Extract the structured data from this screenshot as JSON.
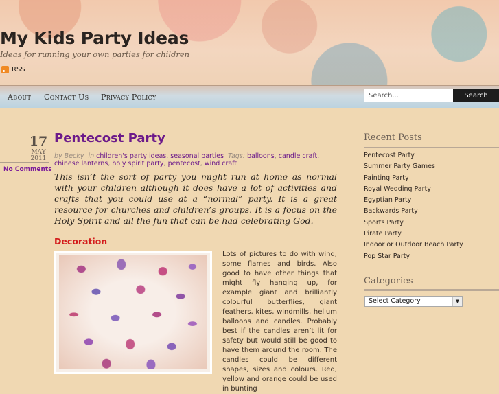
{
  "site": {
    "title": "My Kids Party Ideas",
    "tagline": "Ideas for running your own parties for children",
    "rss_label": "RSS"
  },
  "nav": {
    "items": [
      "About",
      "Contact Us",
      "Privacy Policy"
    ],
    "search_placeholder": "Search...",
    "search_button": "Search"
  },
  "post": {
    "date": {
      "day": "17",
      "month": "MAY",
      "year": "2011"
    },
    "comments": "No Comments",
    "title": "Pentecost Party",
    "meta": {
      "by": "by Becky",
      "in": "in",
      "categories": [
        "children's party ideas",
        "seasonal parties"
      ],
      "tags_label": "Tags:",
      "tags": [
        "balloons",
        "candle craft",
        "chinese lanterns",
        "holy spirit party",
        "pentecost",
        "wind craft"
      ]
    },
    "intro": "This isn’t the sort of party you might run at home as normal with your children although it does have a lot of activities and crafts that you could use at a “normal” party.  It is a great resource for churches and children’s groups.  It is a focus on the Holy Spirit and all the fun that can be had celebrating God.",
    "section_heading": "Decoration",
    "description": "Lots of pictures to do with wind, some flames and birds. Also good to have other things that might fly hanging up, for example giant and brilliantly colourful butterflies, giant feathers, kites, windmills, helium balloons and candles. Probably best if the candles aren’t lit for safety but would still be good to have them around the room.  The candles could be different shapes, sizes and colours. Red, yellow and orange could be used in bunting"
  },
  "sidebar": {
    "recent_heading": "Recent Posts",
    "recent_posts": [
      "Pentecost Party",
      "Summer Party Games",
      "Painting Party",
      "Royal Wedding Party",
      "Egyptian Party",
      "Backwards Party",
      "Sports Party",
      "Pirate Party",
      "Indoor or Outdoor Beach Party",
      "Pop Star Party"
    ],
    "categories_heading": "Categories",
    "categories_select": "Select Category"
  }
}
